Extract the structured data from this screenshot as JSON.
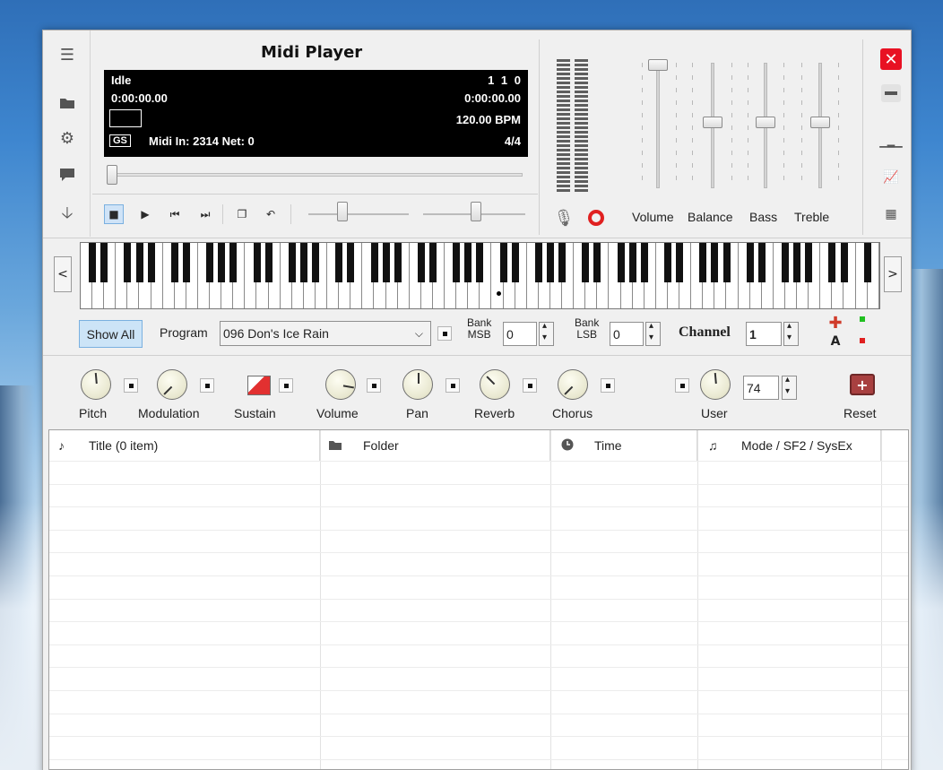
{
  "window": {
    "title": "Midi Player"
  },
  "display": {
    "state": "Idle",
    "elapsed": "0:00:00.00",
    "position": "1   1   0",
    "total": "0:00:00.00",
    "tempo": "120.00 BPM",
    "gs_badge": "GS",
    "midi_in": "Midi In: 2314  Net: 0",
    "time_sig": "4/4"
  },
  "mixer": {
    "labels": [
      "Volume",
      "Balance",
      "Bass",
      "Treble"
    ]
  },
  "program": {
    "show_all": "Show All",
    "program_label": "Program",
    "program_value": "096 Don's Ice Rain",
    "bank_msb_label_1": "Bank",
    "bank_msb_label_2": "MSB",
    "bank_msb_value": "0",
    "bank_lsb_label_1": "Bank",
    "bank_lsb_label_2": "LSB",
    "bank_lsb_value": "0",
    "channel_label": "Channel",
    "channel_value": "1",
    "a_label": "A"
  },
  "controllers": {
    "pitch": "Pitch",
    "modulation": "Modulation",
    "sustain": "Sustain",
    "volume": "Volume",
    "pan": "Pan",
    "reverb": "Reverb",
    "chorus": "Chorus",
    "user": "User",
    "user_value": "74",
    "reset": "Reset"
  },
  "playlist": {
    "columns": [
      "Title (0 item)",
      "Folder",
      "Time",
      "Mode / SF2 / SysEx"
    ]
  },
  "colors": {
    "close": "#e81123",
    "record": "#e02020",
    "add": "#d03b2a",
    "green": "#21c021"
  }
}
